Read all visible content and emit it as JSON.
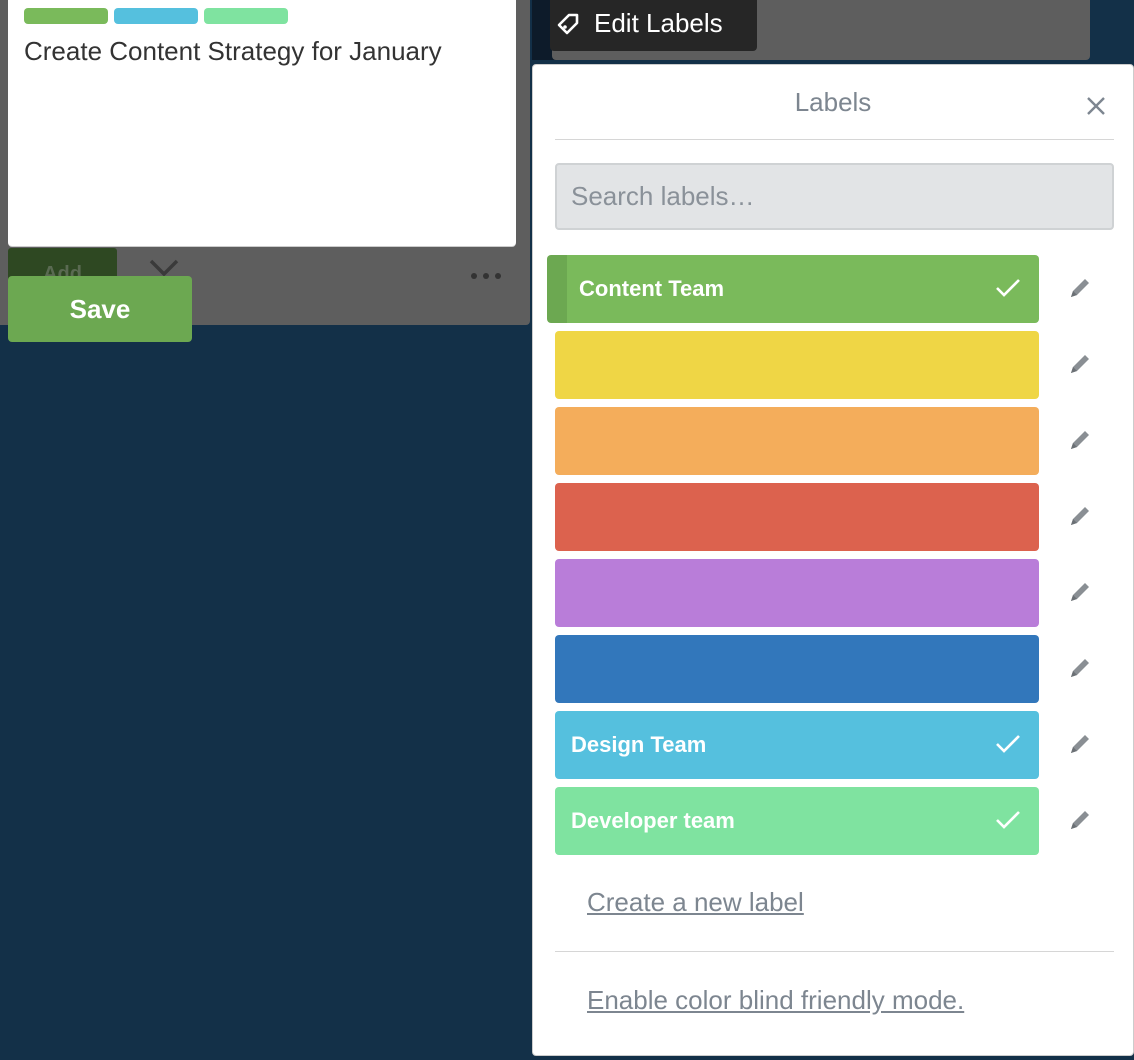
{
  "card": {
    "title": "Create Content Strategy for January",
    "mini_labels": [
      "#7aba5b",
      "#55c0de",
      "#7fe3a0"
    ],
    "add_label": "Add",
    "save_label": "Save"
  },
  "tooltip": {
    "icon": "tag-icon",
    "label": "Edit Labels"
  },
  "popup": {
    "title": "Labels",
    "search_placeholder": "Search labels…",
    "labels": [
      {
        "name": "Content Team",
        "color": "#7aba5b",
        "selected": true
      },
      {
        "name": "",
        "color": "#efd645",
        "selected": false
      },
      {
        "name": "",
        "color": "#f4ad5b",
        "selected": false
      },
      {
        "name": "",
        "color": "#dc624e",
        "selected": false
      },
      {
        "name": "",
        "color": "#b97dd9",
        "selected": false
      },
      {
        "name": "",
        "color": "#3277bb",
        "selected": false
      },
      {
        "name": "Design Team",
        "color": "#55c0de",
        "selected": true
      },
      {
        "name": "Developer team",
        "color": "#7fe3a0",
        "selected": true
      }
    ],
    "create_label": "Create a new label",
    "color_blind_label": "Enable color blind friendly mode."
  }
}
